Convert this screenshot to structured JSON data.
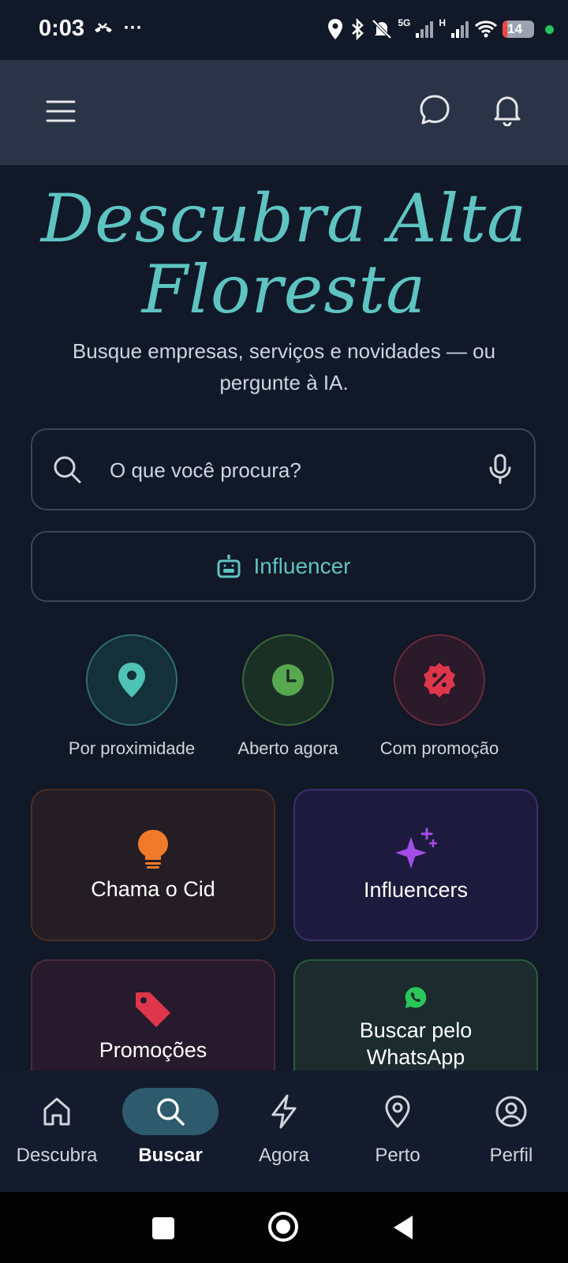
{
  "status_bar": {
    "time": "0:03",
    "network_5g": "5G",
    "network_h": "H",
    "battery": "14",
    "battery_level": 0.14
  },
  "header": {
    "menu_icon": "menu-icon",
    "chat_icon": "chat-icon",
    "bell_icon": "bell-icon"
  },
  "hero": {
    "title_line1": "Descubra Alta",
    "title_line2": "Floresta",
    "subtitle": "Busque empresas, serviços e novidades — ou pergunte à IA."
  },
  "search": {
    "placeholder": "O que você procura?",
    "value": ""
  },
  "influencer_button": {
    "label": "Influencer",
    "icon": "robot-icon"
  },
  "quick_filters": [
    {
      "label": "Por proximidade",
      "icon": "map-pin-icon",
      "color": "#4fc3b4"
    },
    {
      "label": "Aberto agora",
      "icon": "clock-icon",
      "color": "#58a84f"
    },
    {
      "label": "Com promoção",
      "icon": "promo-badge-icon",
      "color": "#e0364c"
    }
  ],
  "cards": [
    {
      "label": "Chama o Cid",
      "icon": "lightbulb-icon",
      "color": "#f07a2a"
    },
    {
      "label": "Influencers",
      "icon": "sparkles-icon",
      "color": "#a34de8"
    },
    {
      "label": "Promoções",
      "icon": "tag-icon",
      "color": "#e0364c"
    },
    {
      "label": "Buscar pelo WhatsApp",
      "icon": "whatsapp-icon",
      "color": "#2cc55a"
    }
  ],
  "bottom_nav": [
    {
      "label": "Descubra",
      "icon": "home-icon",
      "active": false
    },
    {
      "label": "Buscar",
      "icon": "search-icon",
      "active": true
    },
    {
      "label": "Agora",
      "icon": "lightning-icon",
      "active": false
    },
    {
      "label": "Perto",
      "icon": "map-pin-icon",
      "active": false
    },
    {
      "label": "Perfil",
      "icon": "user-circle-icon",
      "active": false
    }
  ],
  "colors": {
    "accent": "#5ec4c2",
    "background": "#111827",
    "header": "#2a3446",
    "active_nav": "#2e5a6e"
  }
}
